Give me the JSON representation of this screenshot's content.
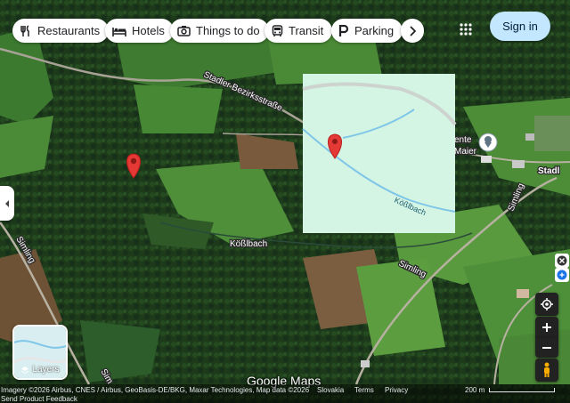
{
  "filter_chips": [
    {
      "label": "Restaurants",
      "icon": "fork-knife-icon"
    },
    {
      "label": "Hotels",
      "icon": "bed-icon"
    },
    {
      "label": "Things to do",
      "icon": "camera-icon"
    },
    {
      "label": "Transit",
      "icon": "bus-icon"
    },
    {
      "label": "Parking",
      "icon": "parking-p-icon"
    }
  ],
  "more_chips_icon": "chevron-right-icon",
  "apps_icon": "grid-icon",
  "signin_label": "Sign in",
  "collapse_icon": "chevron-left-icon",
  "map_labels": {
    "road_top": "Stadler Bezirksstraße",
    "stream_main": "Kößlbach",
    "stream_preview": "Kößlbach",
    "road_left": "Simling",
    "road_bottom": "Simling",
    "road_right": "Simling",
    "road_bottom_left": "Sim",
    "place_partial": "ente",
    "place_partial2": "Maier",
    "village": "Stadl"
  },
  "layers_label": "Layers",
  "logo_text": "Google Maps",
  "footer": {
    "imagery": "Imagery ©2026 Airbus, CNES / Airbus, GeoBasis-DE/BKG, Maxar Technologies, Map data ©2026",
    "country": "Slovakia",
    "terms": "Terms",
    "privacy": "Privacy",
    "scale": "200 m",
    "feedback": "Send Product Feedback"
  },
  "colors": {
    "pin": "#e53935",
    "chip_bg": "#ffffff",
    "signin_bg": "#c2e7ff",
    "preview_bg": "#d4f5e3",
    "stream": "#7fc6e8"
  }
}
